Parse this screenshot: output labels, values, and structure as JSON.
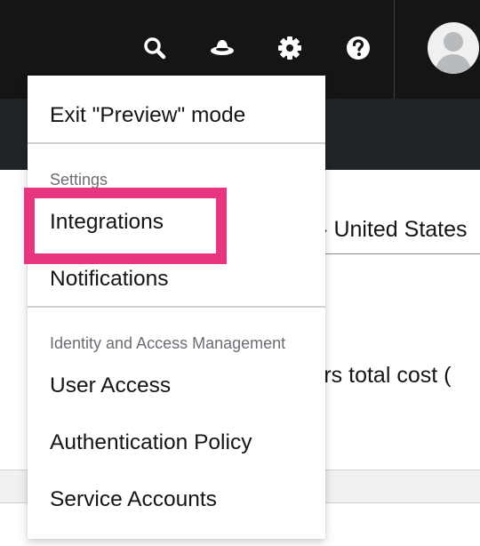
{
  "header": {
    "icons": [
      "search-icon",
      "redhat-icon",
      "gear-icon",
      "help-icon",
      "user-avatar-icon"
    ],
    "accent_color": "#e8357f"
  },
  "background": {
    "currency_select_value": "$) - United States",
    "cost_text": "sters total cost ("
  },
  "menu": {
    "exit_preview_label": "Exit \"Preview\" mode",
    "settings_group_title": "Settings",
    "integrations_label": "Integrations",
    "notifications_label": "Notifications",
    "iam_group_title": "Identity and Access Management",
    "user_access_label": "User Access",
    "auth_policy_label": "Authentication Policy",
    "service_accounts_label": "Service Accounts"
  }
}
